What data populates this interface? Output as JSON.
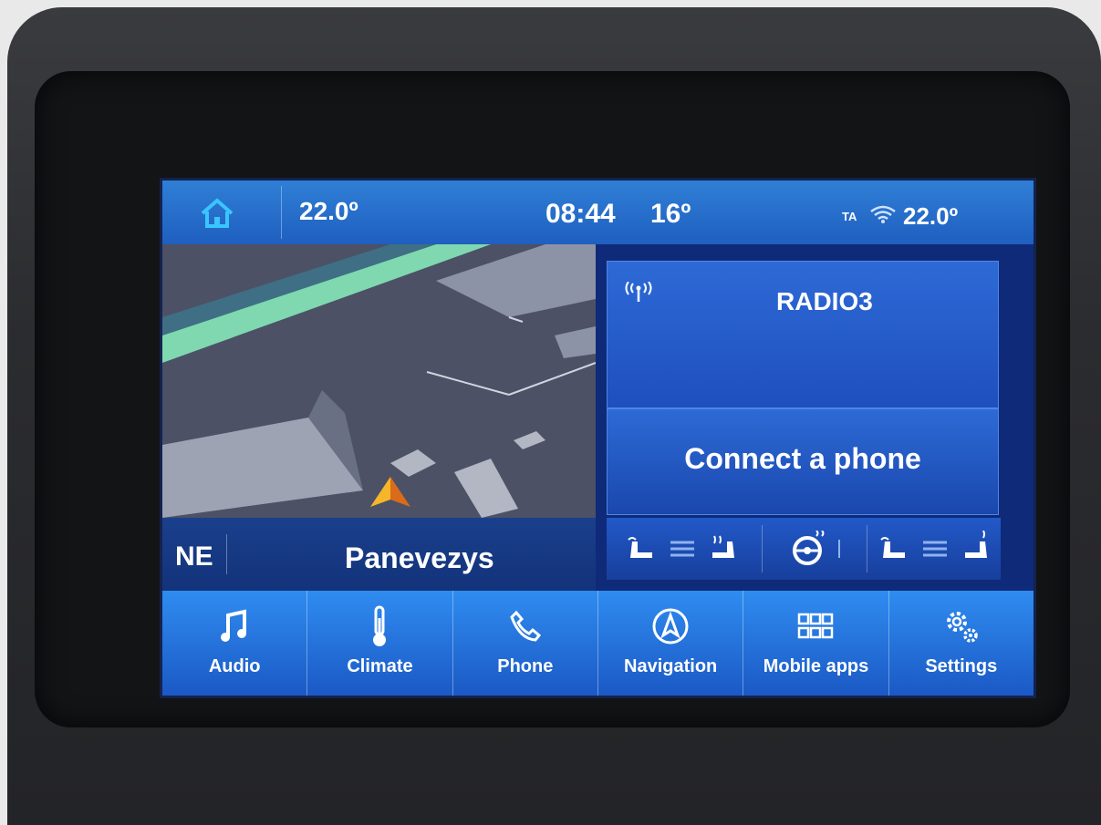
{
  "status_bar": {
    "cabin_temp_left": "22.0º",
    "time": "08:44",
    "outside_temp": "16º",
    "ta_label": "TA",
    "cabin_temp_right": "22.0º"
  },
  "navigation": {
    "heading": "NE",
    "street": "Panevezys"
  },
  "audio_tile": {
    "station": "RADIO3"
  },
  "phone_tile": {
    "label": "Connect a phone"
  },
  "bottom_nav": {
    "audio": "Audio",
    "climate": "Climate",
    "phone": "Phone",
    "navigation": "Navigation",
    "mobile_apps": "Mobile apps",
    "settings": "Settings"
  },
  "colors": {
    "accent": "#2f8cf0",
    "status_bar": "#2f7fd6",
    "home_icon": "#39c6ff",
    "nav_arrow": "#f5a21b"
  }
}
